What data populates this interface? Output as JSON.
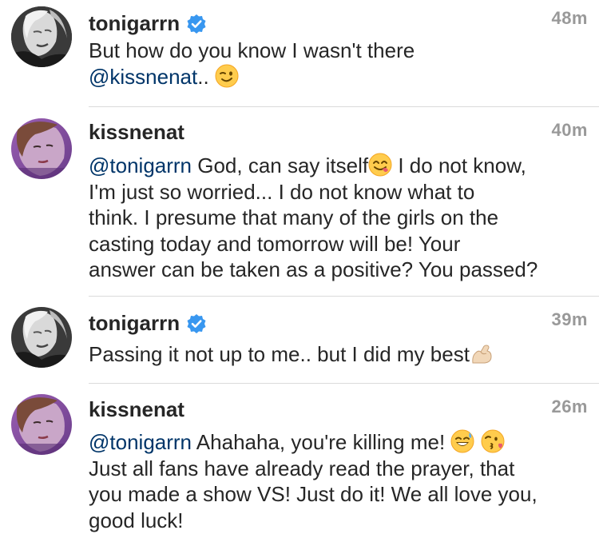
{
  "comments": [
    {
      "username": "tonigarrn",
      "verified": true,
      "time": "48m",
      "mention": "",
      "text_lines": [
        "But how do you know I wasn't there"
      ],
      "line2_mention": "@kissnenat",
      "line2_text": "..",
      "emoji": "winking-face"
    },
    {
      "username": "kissnenat",
      "verified": false,
      "time": "40m",
      "mention": "@tonigarrn",
      "first_text": " God, can say itself",
      "first_text_after": " I do not know,",
      "lines": [
        "I'm just so worried... I do not know what to",
        "think. I presume that many of the girls on the",
        "casting today and tomorrow will be! Your",
        "answer can be taken as a positive? You passed?"
      ],
      "emoji": "face-savoring-food"
    },
    {
      "username": "tonigarrn",
      "verified": true,
      "time": "39m",
      "text": "Passing it not up to me.. but I did my best",
      "emoji": "flexed-biceps"
    },
    {
      "username": "kissnenat",
      "verified": false,
      "time": "26m",
      "mention": "@tonigarrn",
      "first_text": " Ahahaha, you're killing me!",
      "lines": [
        "Just all fans have already read the prayer, that",
        "you made a show VS! Just do it! We all love you,",
        "good luck!"
      ],
      "emojis": [
        "grinning-face-with-sweat",
        "face-throwing-kiss"
      ]
    }
  ],
  "colors": {
    "text": "#262626",
    "mention": "#003569",
    "timestamp": "#999999",
    "verified": "#3897f0",
    "divider": "#dbdbdb"
  }
}
